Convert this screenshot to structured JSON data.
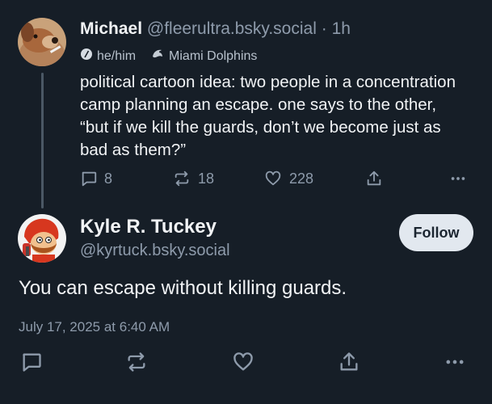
{
  "parent_post": {
    "author_name": "Michael",
    "author_handle": "@fleerultra.bsky.social",
    "separator": "·",
    "time": "1h",
    "pronouns": "he/him",
    "team_badge": "Miami Dolphins",
    "text": "political cartoon idea: two people in a concentration camp planning an escape. one says to the other, “but if we kill the guards, don’t we become just as bad as them?”",
    "reply_count": "8",
    "repost_count": "18",
    "like_count": "228"
  },
  "reply_post": {
    "author_name": "Kyle R. Tuckey",
    "author_handle": "@kyrtuck.bsky.social",
    "follow_label": "Follow",
    "text": "You can escape without killing guards.",
    "date": "July 17, 2025 at 6:40 AM"
  },
  "icons": {
    "reply": "speech-bubble-icon",
    "repost": "repost-arrows-icon",
    "like": "heart-icon",
    "share": "share-upload-icon",
    "more": "more-dots-icon",
    "pronouns": "slash-circle-icon",
    "team": "dolphin-icon"
  },
  "colors": {
    "background": "#161e27",
    "text_primary": "#f1f3f5",
    "text_secondary": "#8e9bab",
    "follow_button_bg": "#e2e8ef",
    "thread_line": "#4b5865"
  }
}
